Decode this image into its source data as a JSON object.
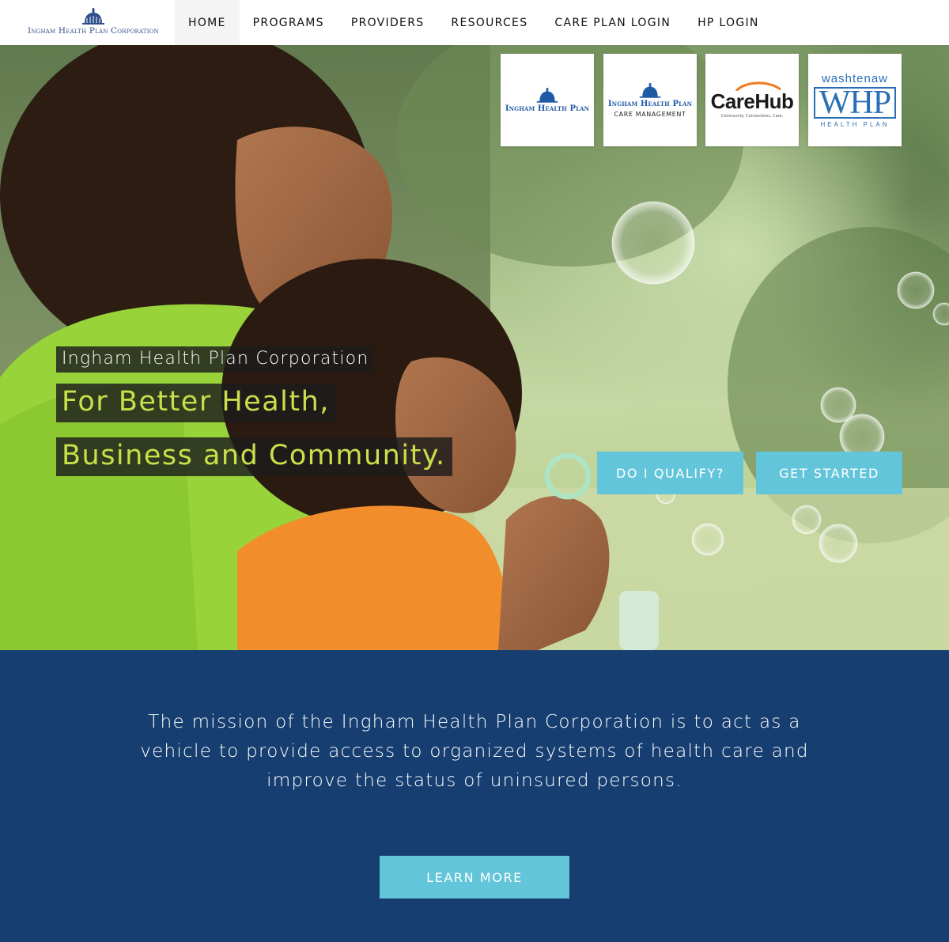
{
  "header": {
    "brand_text": "Ingham Health Plan Corporation",
    "nav": [
      {
        "label": "HOME",
        "active": true
      },
      {
        "label": "PROGRAMS"
      },
      {
        "label": "PROVIDERS"
      },
      {
        "label": "RESOURCES"
      },
      {
        "label": "CARE PLAN LOGIN"
      },
      {
        "label": "HP LOGIN"
      }
    ]
  },
  "partner_logos": {
    "ihp": {
      "main": "Ingham Health Plan"
    },
    "care_management": {
      "main": "Ingham Health Plan",
      "sub": "CARE MANAGEMENT"
    },
    "carehub": {
      "word": "CareHub",
      "tagline": "Community. Connections. Care."
    },
    "whp": {
      "top": "washtenaw",
      "letters": "WHP",
      "bottom": "HEALTH PLAN"
    }
  },
  "hero": {
    "org_name": "Ingham Health Plan Corporation",
    "tagline_line1": "For Better Health,",
    "tagline_line2": "Business and Community.",
    "buttons": {
      "qualify": "DO I QUALIFY?",
      "get_started": "GET STARTED"
    }
  },
  "mission": {
    "text": "The mission of the Ingham Health Plan Corporation is to act as a vehicle to provide access to organized systems of health care and improve the status of uninsured persons.",
    "button": "LEARN MORE"
  },
  "colors": {
    "accent": "#63c5d9",
    "navy": "#163e70",
    "lime_text": "#c8e04a",
    "brand_blue": "#2f4f8c"
  }
}
